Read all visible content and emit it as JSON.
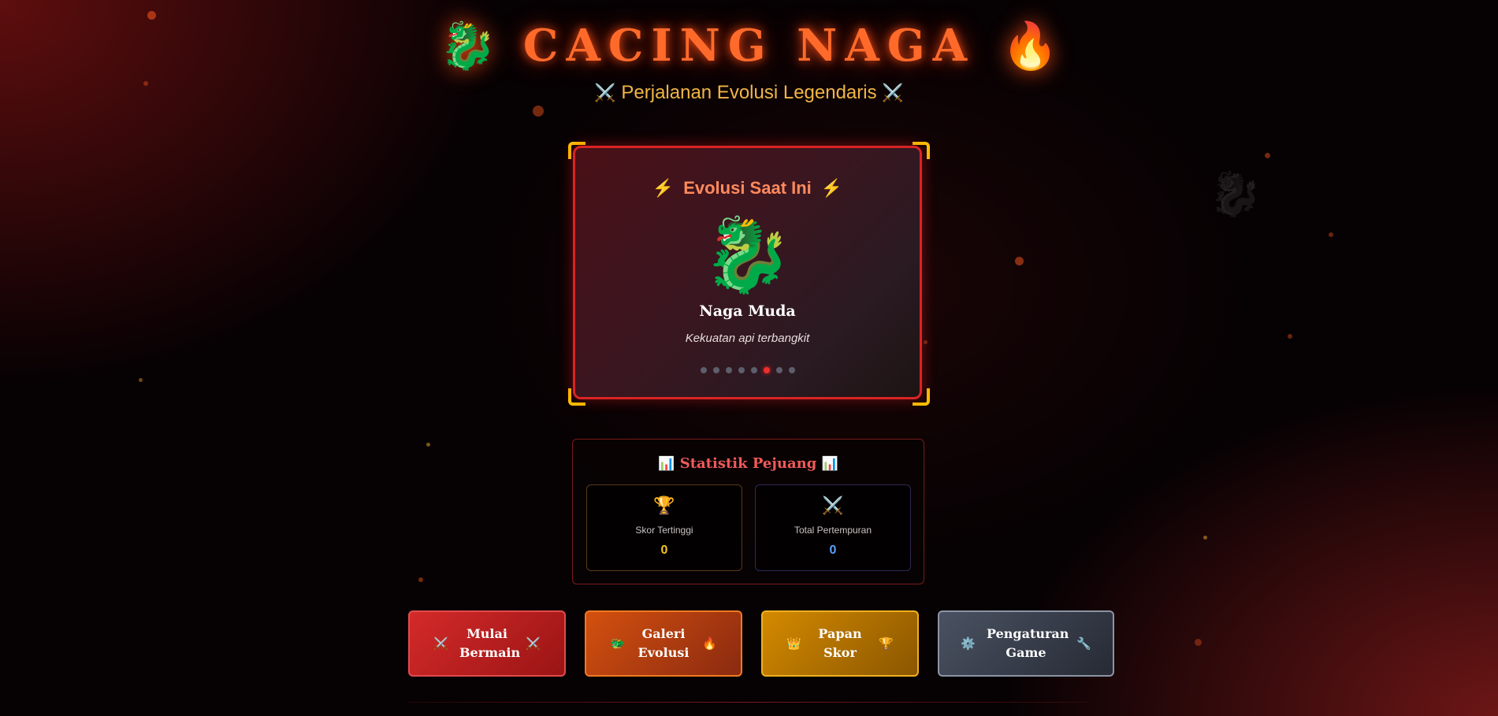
{
  "header": {
    "title": "CACING NAGA",
    "title_icon_left": "🐉",
    "title_icon_right": "🔥",
    "subtitle": "Perjalanan Evolusi Legendaris",
    "subtitle_icon": "⚔️"
  },
  "evolution": {
    "heading": "Evolusi Saat Ini",
    "heading_icon": "⚡",
    "dragon_icon": "🐉",
    "stage_name": "Naga Muda",
    "stage_description": "Kekuatan api terbangkit",
    "stage_count": 8,
    "current_stage_index": 5
  },
  "stats": {
    "title": "Statistik Pejuang",
    "title_icon": "📊",
    "high_score": {
      "icon": "🏆",
      "label": "Skor Tertinggi",
      "value": "0"
    },
    "total_battles": {
      "icon": "⚔️",
      "label": "Total Pertempuran",
      "value": "0"
    }
  },
  "buttons": {
    "play": {
      "label": "Mulai Bermain",
      "icon_left": "⚔️",
      "icon_right": "⚔️"
    },
    "gallery": {
      "label": "Galeri Evolusi",
      "icon_left": "🐲",
      "icon_right": "🔥"
    },
    "leaderboard": {
      "label": "Papan Skor",
      "icon_left": "👑",
      "icon_right": "🏆"
    },
    "settings": {
      "label": "Pengaturan Game",
      "icon_left": "⚙️",
      "icon_right": "🔧"
    }
  },
  "colors": {
    "accent_red": "#d92424",
    "title_orange": "#ff6a2a",
    "subtitle_gold": "#f2b545",
    "corner_gold": "#ffc400"
  }
}
